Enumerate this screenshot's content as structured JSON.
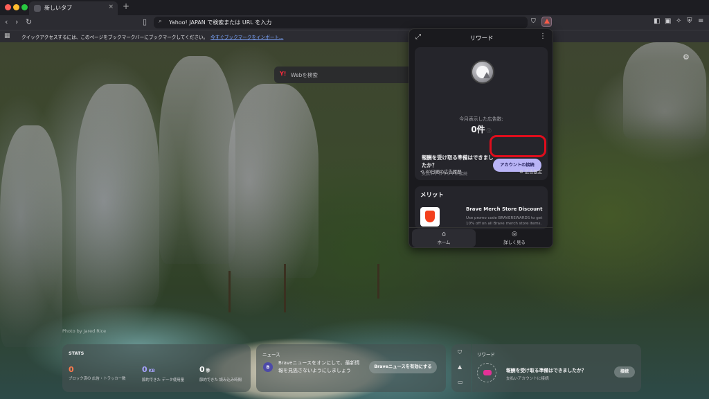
{
  "browser": {
    "tab_title": "新しいタブ",
    "tab_close": "×",
    "new_tab": "+",
    "url_placeholder": "Yahoo! JAPAN で検索または URL を入力"
  },
  "bookmark_bar": {
    "message": "クイックアクセスするには、このページをブックマークバーにブックマークしてください。",
    "import_link": "今すぐブックマークをインポート..."
  },
  "search": {
    "engine_mark": "Y!",
    "placeholder": "Webを検索"
  },
  "photo_credit": "Photo by Jared Rice",
  "rewards_popup": {
    "title": "リワード",
    "ads_label": "今月表示した広告数:",
    "ads_count": "0件",
    "ready_text": "報酬を受け取る準備はできましたか？",
    "ready_sub": "支払いアカウントに接続",
    "connect_button": "アカウントの接続",
    "history_link": "30日間の広告履歴",
    "ad_settings_link": "広告設定",
    "benefits_title": "メリット",
    "merch_title": "Brave Merch Store Discount",
    "merch_desc": "Use promo code BRAVEREWARDS to get 10% off on all Brave merch store items.",
    "nav_home": "ホーム",
    "nav_more": "詳しく見る"
  },
  "stats_widget": {
    "title": "STATS",
    "blocked_value": "0",
    "blocked_label": "ブロック済の 広告・トラッカー数",
    "saved_value": "0",
    "saved_unit": "KB",
    "saved_label": "節約できた データ使用量",
    "time_value": "0",
    "time_unit": "秒",
    "time_label": "節約できた 読み込み時間"
  },
  "news_widget": {
    "title": "ニュース",
    "badge": "B",
    "text": "Braveニュースをオンにして、最新情報を見逃さないようにしましょう",
    "button": "Braveニュースを有効にする"
  },
  "rewards_widget": {
    "title": "リワード",
    "text": "報酬を受け取る準備はできましたか？",
    "sub": "支払いアカウントに接続",
    "button": "接続"
  },
  "colors": {
    "accent_button": "#b9b4f6",
    "highlight_ring": "#e00d1c",
    "stat_orange": "#ff7a4d",
    "stat_purple": "#a7a3ff",
    "stat_white": "#ffffff",
    "brave_orange": "#f33f1c"
  }
}
